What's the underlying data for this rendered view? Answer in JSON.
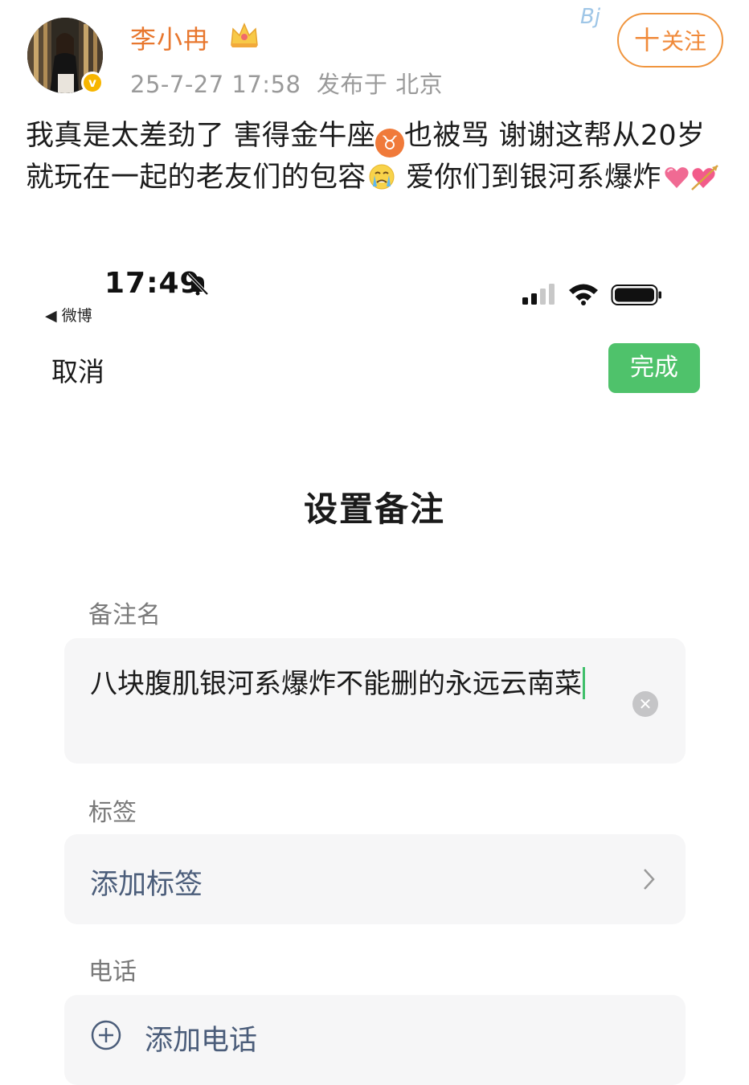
{
  "post": {
    "username": "李小冉",
    "timestamp": "25-7-27 17:58",
    "location": "发布于 北京",
    "follow_label": "关注",
    "follow_plus": "十",
    "verify_mark": "v",
    "text_part1": "我真是太差劲了 害得金牛座",
    "taurus_emoji": "♉",
    "text_part2": "也被骂 谢谢这帮从20岁就玩在一起的老友们的包容",
    "text_part3": " 爱你们到银河系爆炸",
    "icons": [
      "crown-icon",
      "taurus-emoji",
      "crying-face-emoji",
      "heart-emoji",
      "heart-arrow-emoji"
    ],
    "colors": {
      "username": "#e8772e",
      "follow_border": "#f0953e",
      "verify": "#f7b500"
    }
  },
  "status_bar": {
    "time": "17:49",
    "back_app": "◀ 微博",
    "icons": [
      "bell-off-icon",
      "signal-icon",
      "wifi-icon",
      "battery-icon"
    ]
  },
  "edit_remark": {
    "cancel_label": "取消",
    "done_label": "完成",
    "title": "设置备注",
    "remark_label": "备注名",
    "remark_value": "八块腹肌银河系爆炸不能删的永远云南菜",
    "tag_label": "标签",
    "add_tag": "添加标签",
    "phone_label": "电话",
    "add_phone": "添加电话",
    "colors": {
      "done_button": "#4fc26b",
      "caret": "#3fbf6a",
      "link_text": "#4b5d7a"
    }
  }
}
